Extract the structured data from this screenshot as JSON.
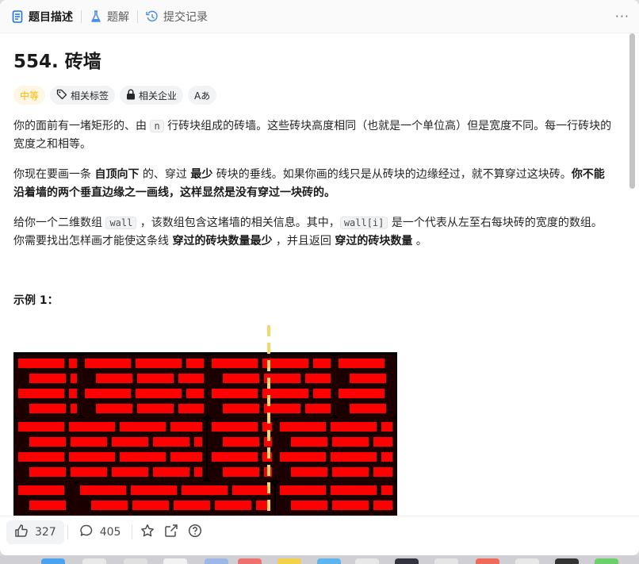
{
  "tabs": [
    {
      "label": "题目描述",
      "icon": "document-icon"
    },
    {
      "label": "题解",
      "icon": "flask-icon"
    },
    {
      "label": "提交记录",
      "icon": "history-icon"
    }
  ],
  "more_label": "···",
  "problem": {
    "title": "554. 砖墙",
    "difficulty": "中等",
    "tags": [
      "相关标签",
      "相关企业",
      "Aあ"
    ],
    "p1": {
      "a": "你的面前有一堵矩形的、由 ",
      "code": "n",
      "b": " 行砖块组成的砖墙。这些砖块高度相同（也就是一个单位高）但是宽度不同。每一行砖块的宽度之和相等。"
    },
    "p2": {
      "a": "你现在要画一条 ",
      "b1": "自顶向下",
      "c": " 的、穿过 ",
      "b2": "最少",
      "d": " 砖块的垂线。如果你画的线只是从砖块的边缘经过，就不算穿过这块砖。",
      "b3": "你不能沿着墙的两个垂直边缘之一画线，这样显然是没有穿过一块砖的。"
    },
    "p3": {
      "a": "给你一个二维数组 ",
      "code1": "wall",
      "b": " ，该数组包含这堵墙的相关信息。其中，",
      "code2": "wall[i]",
      "c": " 是一个代表从左至右每块砖的宽度的数组。你需要找出怎样画才能使这条线 ",
      "b1": "穿过的砖块数量最少",
      "d": " ，并且返回 ",
      "b2": "穿过的砖块数量",
      "e": " 。"
    },
    "example_label": "示例 1："
  },
  "actions": {
    "likes": "327",
    "comments": "405"
  },
  "colors": {
    "brick": "#ff0000",
    "mortar": "#000000",
    "line": "#f5d66b",
    "difficulty": "#ffb800"
  }
}
